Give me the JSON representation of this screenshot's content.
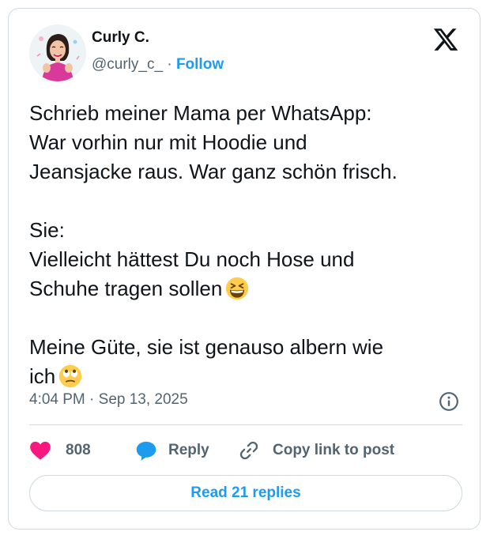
{
  "author": {
    "name": "Curly C.",
    "handle": "@curly_c_",
    "separator": "·",
    "follow_label": "Follow"
  },
  "tweet": {
    "paragraphs": [
      [
        "Schrieb meiner Mama per WhatsApp:",
        "War vorhin nur mit Hoodie und",
        "Jeansjacke raus. War ganz schön frisch."
      ],
      [
        "Sie:",
        "Vielleicht hättest Du noch Hose und",
        "Schuhe tragen sollen"
      ],
      [
        "Meine Güte, sie ist genauso albern wie",
        "ich"
      ]
    ],
    "emoji_1": "grinning-squinting-face-icon",
    "emoji_2": "face-with-rolling-eyes-icon",
    "timestamp": "4:04 PM · Sep 13, 2025"
  },
  "actions": {
    "likes_count": "808",
    "reply_label": "Reply",
    "copy_link_label": "Copy link to post"
  },
  "read_replies_label": "Read 21 replies",
  "colors": {
    "accent": "#1d9bf0",
    "like": "#f91880",
    "text": "#0f1419",
    "muted": "#536471",
    "border": "#cfd9de"
  }
}
